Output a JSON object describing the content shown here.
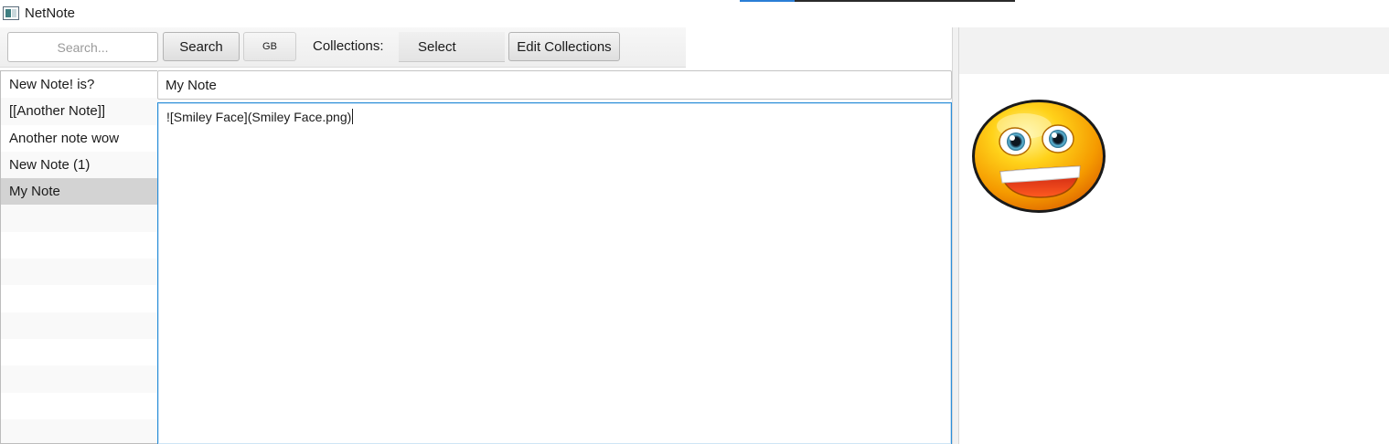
{
  "window": {
    "title": "NetNote"
  },
  "toolbar": {
    "search_placeholder": "Search...",
    "search_label": "Search",
    "language_label": "GB",
    "collections_label": "Collections:",
    "collections_selected": "Select",
    "edit_collections_label": "Edit Collections"
  },
  "notes": [
    {
      "title": "New Note! is?"
    },
    {
      "title": "[[Another Note]]"
    },
    {
      "title": "Another note wow"
    },
    {
      "title": "New Note (1)"
    },
    {
      "title": "My Note"
    }
  ],
  "selected_note": "My Note",
  "editor": {
    "title": "My Note",
    "content": "![Smiley Face](Smiley Face.png)"
  },
  "preview": {
    "image_alt": "Smiley Face"
  },
  "colors": {
    "accent": "#2b8ed9",
    "selected_row": "#d3d3d3"
  }
}
